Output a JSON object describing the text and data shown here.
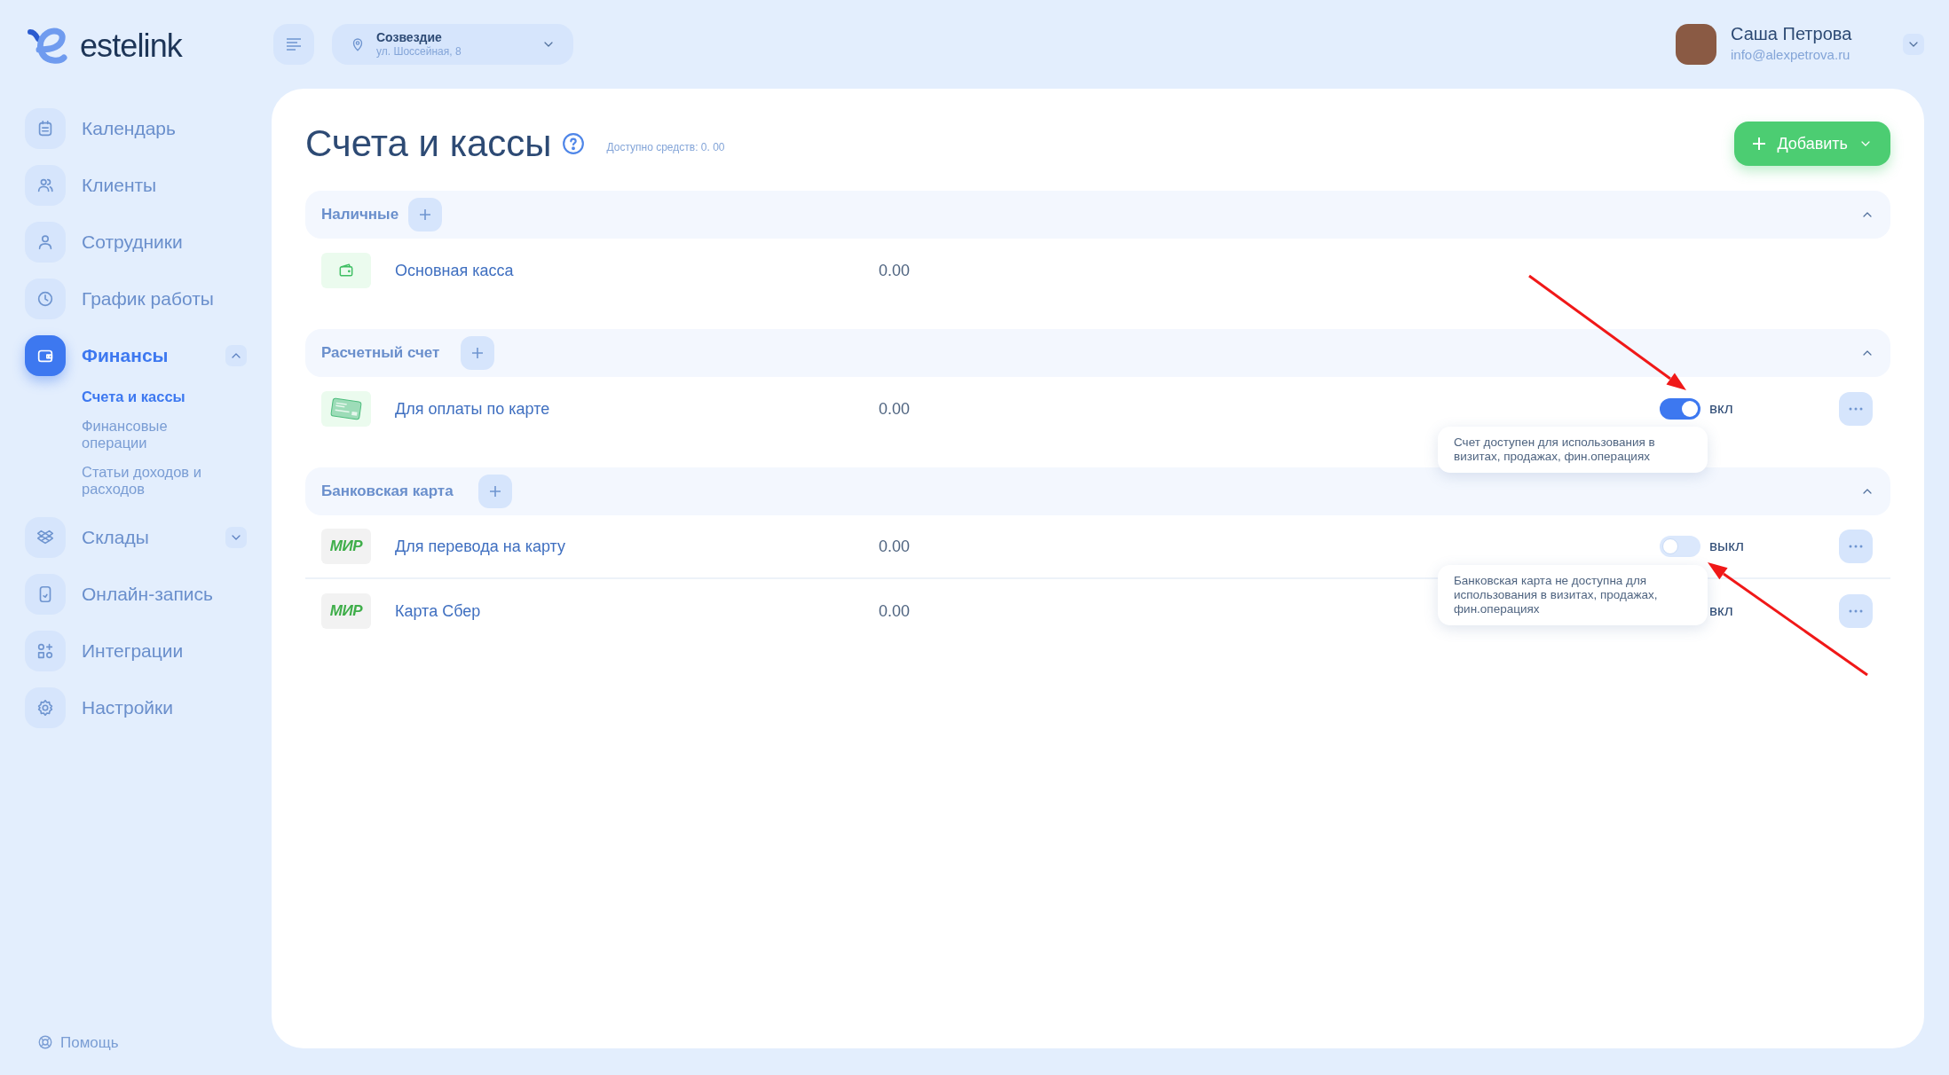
{
  "logo": {
    "text": "estelink"
  },
  "location": {
    "name": "Созвездие",
    "address": "ул. Шоссейная, 8"
  },
  "user": {
    "name": "Саша Петрова",
    "email": "info@alexpetrova.ru"
  },
  "sidebar": {
    "items": [
      {
        "kind": "calendar",
        "label": "Календарь",
        "selected": false
      },
      {
        "kind": "clients",
        "label": "Клиенты",
        "selected": false
      },
      {
        "kind": "staff",
        "label": "Сотрудники",
        "selected": false
      },
      {
        "kind": "clock",
        "label": "График работы",
        "selected": false
      },
      {
        "kind": "wallet",
        "label": "Финансы",
        "selected": true,
        "expanded": true,
        "children": [
          {
            "label": "Счета и кассы",
            "selected": true
          },
          {
            "label": "Финансовые операции",
            "selected": false
          },
          {
            "label": "Статьи доходов и расходов",
            "selected": false
          }
        ]
      },
      {
        "kind": "boxes",
        "label": "Склады",
        "selected": false,
        "expanded": false
      },
      {
        "kind": "phone",
        "label": "Онлайн-запись",
        "selected": false
      },
      {
        "kind": "apps",
        "label": "Интеграции",
        "selected": false
      },
      {
        "kind": "gear",
        "label": "Настройки",
        "selected": false
      }
    ]
  },
  "help": "Помощь",
  "page": {
    "title": "Счета и кассы",
    "available": "Доступно средств: 0. 00",
    "add_button": "Добавить"
  },
  "groups": [
    {
      "title": "Наличные",
      "expanded": true,
      "rows": [
        {
          "kind": "cash",
          "name": "Основная касса",
          "amount": "0.00"
        }
      ]
    },
    {
      "title": "Расчетный счет",
      "expanded": true,
      "rows": [
        {
          "kind": "card",
          "name": "Для оплаты по карте",
          "amount": "0.00",
          "on": true,
          "status": "вкл",
          "tooltip": "Счет доступен для использования в визитах, продажах, фин.операциях"
        }
      ]
    },
    {
      "title": "Банковская карта",
      "expanded": true,
      "rows": [
        {
          "kind": "mir",
          "logo": "МИР",
          "name": "Для перевода на карту",
          "amount": "0.00",
          "on": false,
          "status": "выкл",
          "tooltip": "Банковская карта не доступна для использования в визитах, продажах, фин.операциях"
        },
        {
          "kind": "mir",
          "logo": "МИР",
          "name": "Карта Сбер",
          "amount": "0.00",
          "status": "вкл"
        }
      ]
    }
  ]
}
